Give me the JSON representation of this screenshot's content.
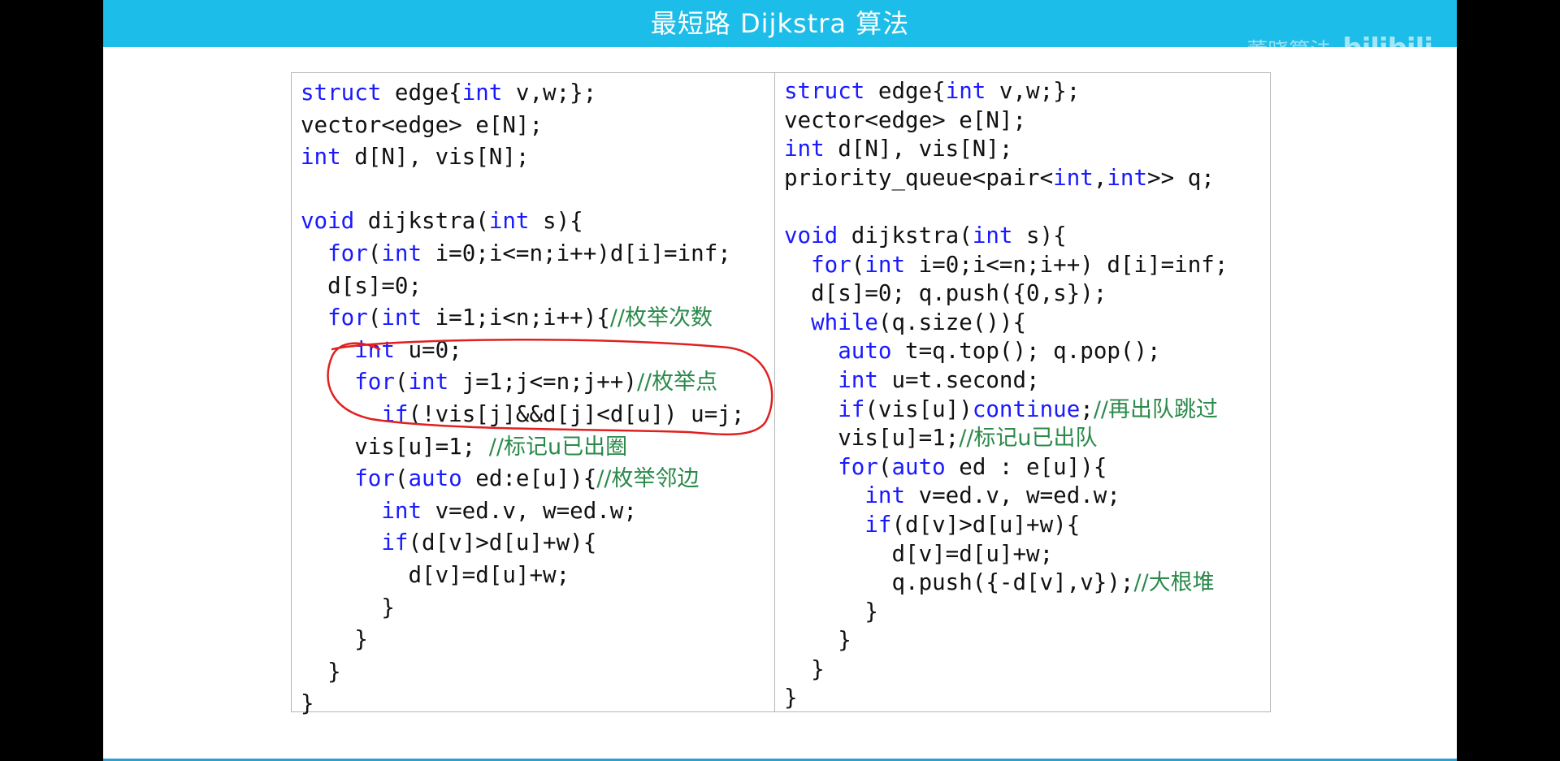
{
  "slide": {
    "title": "最短路 Dijkstra 算法",
    "watermark": {
      "text": "董晓算法",
      "logo": "bilibili"
    },
    "accent_color": "#1cbde8",
    "keyword_color": "#1a1aff",
    "comment_color": "#2a8a4a",
    "annotation_color": "#e02020"
  },
  "left_code": [
    [
      [
        "t",
        "struct"
      ],
      [
        "p",
        " edge{"
      ],
      [
        "t",
        "int"
      ],
      [
        "p",
        " v,w;};"
      ]
    ],
    [
      [
        "p",
        "vector<edge> e[N];"
      ]
    ],
    [
      [
        "t",
        "int"
      ],
      [
        "p",
        " d[N], vis[N];"
      ]
    ],
    [
      [
        "p",
        ""
      ]
    ],
    [
      [
        "t",
        "void"
      ],
      [
        "p",
        " dijkstra("
      ],
      [
        "t",
        "int"
      ],
      [
        "p",
        " s){"
      ]
    ],
    [
      [
        "p",
        "  "
      ],
      [
        "t",
        "for"
      ],
      [
        "p",
        "("
      ],
      [
        "t",
        "int"
      ],
      [
        "p",
        " i=0;i<=n;i++)d[i]=inf;"
      ]
    ],
    [
      [
        "p",
        "  d[s]=0;"
      ]
    ],
    [
      [
        "p",
        "  "
      ],
      [
        "t",
        "for"
      ],
      [
        "p",
        "("
      ],
      [
        "t",
        "int"
      ],
      [
        "p",
        " i=1;i<n;i++){"
      ],
      [
        "c",
        "//枚举次数"
      ]
    ],
    [
      [
        "p",
        "    "
      ],
      [
        "t",
        "int"
      ],
      [
        "p",
        " u=0;"
      ]
    ],
    [
      [
        "p",
        "    "
      ],
      [
        "t",
        "for"
      ],
      [
        "p",
        "("
      ],
      [
        "t",
        "int"
      ],
      [
        "p",
        " j=1;j<=n;j++)"
      ],
      [
        "c",
        "//枚举点"
      ]
    ],
    [
      [
        "p",
        "      "
      ],
      [
        "t",
        "if"
      ],
      [
        "p",
        "(!vis[j]&&d[j]<d[u]) u=j;"
      ]
    ],
    [
      [
        "p",
        "    vis[u]=1; "
      ],
      [
        "c",
        "//标记u已出圈"
      ]
    ],
    [
      [
        "p",
        "    "
      ],
      [
        "t",
        "for"
      ],
      [
        "p",
        "("
      ],
      [
        "t",
        "auto"
      ],
      [
        "p",
        " ed:e[u]){"
      ],
      [
        "c",
        "//枚举邻边"
      ]
    ],
    [
      [
        "p",
        "      "
      ],
      [
        "t",
        "int"
      ],
      [
        "p",
        " v=ed.v, w=ed.w;"
      ]
    ],
    [
      [
        "p",
        "      "
      ],
      [
        "t",
        "if"
      ],
      [
        "p",
        "(d[v]>d[u]+w){"
      ]
    ],
    [
      [
        "p",
        "        d[v]=d[u]+w;"
      ]
    ],
    [
      [
        "p",
        "      }"
      ]
    ],
    [
      [
        "p",
        "    }"
      ]
    ],
    [
      [
        "p",
        "  }"
      ]
    ],
    [
      [
        "p",
        "}"
      ]
    ]
  ],
  "right_code": [
    [
      [
        "t",
        "struct"
      ],
      [
        "p",
        " edge{"
      ],
      [
        "t",
        "int"
      ],
      [
        "p",
        " v,w;};"
      ]
    ],
    [
      [
        "p",
        "vector<edge> e[N];"
      ]
    ],
    [
      [
        "t",
        "int"
      ],
      [
        "p",
        " d[N], vis[N];"
      ]
    ],
    [
      [
        "p",
        "priority_queue<pair<"
      ],
      [
        "t",
        "int"
      ],
      [
        "p",
        ","
      ],
      [
        "t",
        "int"
      ],
      [
        "p",
        ">> q;"
      ]
    ],
    [
      [
        "p",
        ""
      ]
    ],
    [
      [
        "t",
        "void"
      ],
      [
        "p",
        " dijkstra("
      ],
      [
        "t",
        "int"
      ],
      [
        "p",
        " s){"
      ]
    ],
    [
      [
        "p",
        "  "
      ],
      [
        "t",
        "for"
      ],
      [
        "p",
        "("
      ],
      [
        "t",
        "int"
      ],
      [
        "p",
        " i=0;i<=n;i++) d[i]=inf;"
      ]
    ],
    [
      [
        "p",
        "  d[s]=0; q.push({0,s});"
      ]
    ],
    [
      [
        "p",
        "  "
      ],
      [
        "t",
        "while"
      ],
      [
        "p",
        "(q.size()){"
      ]
    ],
    [
      [
        "p",
        "    "
      ],
      [
        "t",
        "auto"
      ],
      [
        "p",
        " t=q.top(); q.pop();"
      ]
    ],
    [
      [
        "p",
        "    "
      ],
      [
        "t",
        "int"
      ],
      [
        "p",
        " u=t.second;"
      ]
    ],
    [
      [
        "p",
        "    "
      ],
      [
        "t",
        "if"
      ],
      [
        "p",
        "(vis[u])"
      ],
      [
        "t",
        "continue"
      ],
      [
        "p",
        ";"
      ],
      [
        "c",
        "//再出队跳过"
      ]
    ],
    [
      [
        "p",
        "    vis[u]=1;"
      ],
      [
        "c",
        "//标记u已出队"
      ]
    ],
    [
      [
        "p",
        "    "
      ],
      [
        "t",
        "for"
      ],
      [
        "p",
        "("
      ],
      [
        "t",
        "auto"
      ],
      [
        "p",
        " ed : e[u]){"
      ]
    ],
    [
      [
        "p",
        "      "
      ],
      [
        "t",
        "int"
      ],
      [
        "p",
        " v=ed.v, w=ed.w;"
      ]
    ],
    [
      [
        "p",
        "      "
      ],
      [
        "t",
        "if"
      ],
      [
        "p",
        "(d[v]>d[u]+w){"
      ]
    ],
    [
      [
        "p",
        "        d[v]=d[u]+w;"
      ]
    ],
    [
      [
        "p",
        "        q.push({-d[v],v});"
      ],
      [
        "c",
        "//大根堆"
      ]
    ],
    [
      [
        "p",
        "      }"
      ]
    ],
    [
      [
        "p",
        "    }"
      ]
    ],
    [
      [
        "p",
        "  }"
      ]
    ],
    [
      [
        "p",
        "}"
      ]
    ]
  ]
}
